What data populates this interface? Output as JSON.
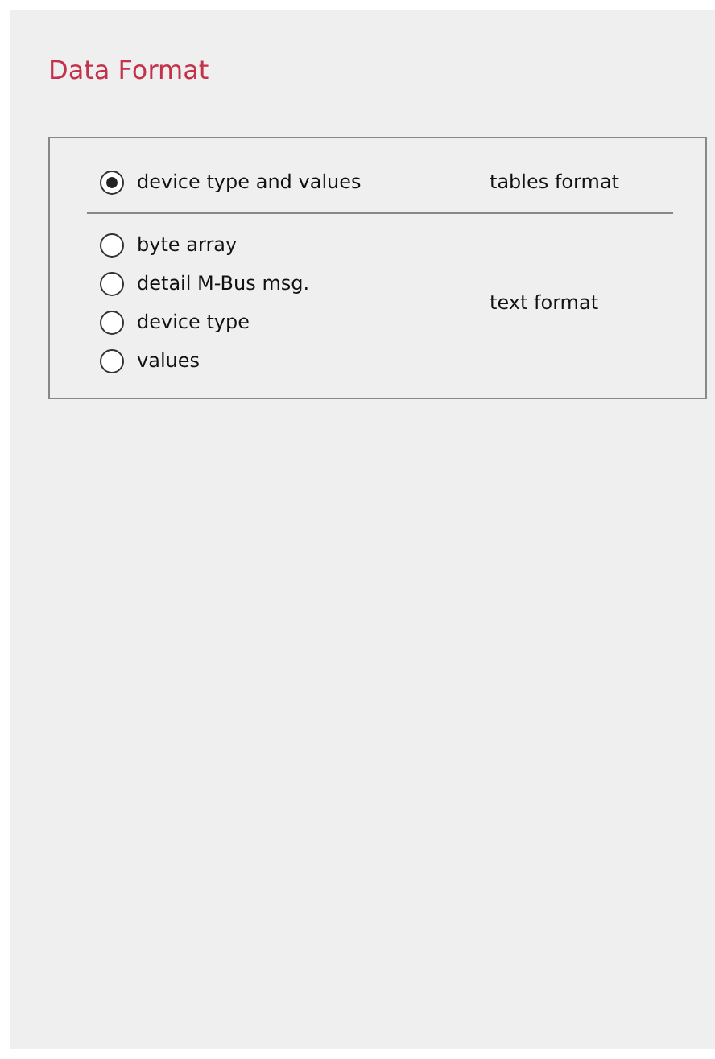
{
  "title": "Data Format",
  "sections": [
    {
      "label": "tables format",
      "options": [
        {
          "label": "device type and values",
          "selected": true
        }
      ]
    },
    {
      "label": "text format",
      "options": [
        {
          "label": "byte array",
          "selected": false
        },
        {
          "label": "detail M-Bus msg.",
          "selected": false
        },
        {
          "label": "device type",
          "selected": false
        },
        {
          "label": "values",
          "selected": false
        }
      ]
    }
  ]
}
